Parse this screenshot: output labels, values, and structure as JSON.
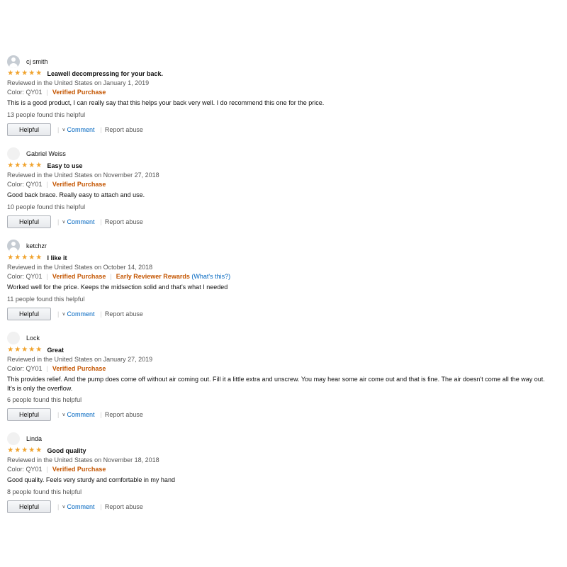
{
  "reviews": [
    {
      "name": "cj smith",
      "avatar": "filled",
      "stars": 5,
      "title": "Leawell decompressing for your back.",
      "date": "Reviewed in the United States on January 1, 2019",
      "color": "Color: QY01",
      "verified": "Verified Purchase",
      "body": "This is a good product, I can really say that this helps your back very well. I do recommend this one for the price.",
      "helpful_count": "13 people found this helpful",
      "helpful_label": "Helpful",
      "comment_label": "Comment",
      "report_label": "Report abuse"
    },
    {
      "name": "Gabriel Weiss",
      "avatar": "blank",
      "stars": 5,
      "title": "Easy to use",
      "date": "Reviewed in the United States on November 27, 2018",
      "color": "Color: QY01",
      "verified": "Verified Purchase",
      "body": "Good back brace. Really easy to attach and use.",
      "helpful_count": "10 people found this helpful",
      "helpful_label": "Helpful",
      "comment_label": "Comment",
      "report_label": "Report abuse"
    },
    {
      "name": "ketchzr",
      "avatar": "filled",
      "stars": 5,
      "title": "I like it",
      "date": "Reviewed in the United States on October 14, 2018",
      "color": "Color: QY01",
      "verified": "Verified Purchase",
      "early_reviewer": "Early Reviewer Rewards",
      "whats_this": "(What's this?)",
      "body": "Worked well for the price. Keeps the midsection solid and that's what I needed",
      "helpful_count": "11 people found this helpful",
      "helpful_label": "Helpful",
      "comment_label": "Comment",
      "report_label": "Report abuse"
    },
    {
      "name": "Lock",
      "avatar": "blank",
      "stars": 5,
      "title": "Great",
      "date": "Reviewed in the United States on January 27, 2019",
      "color": "Color: QY01",
      "verified": "Verified Purchase",
      "body": "This provides relief. And the pump does come off without air coming out. Fill it a little extra and unscrew. You may hear some air come out and that is fine. The air doesn't come all the way out. It's is only the overflow.",
      "helpful_count": "6 people found this helpful",
      "helpful_label": "Helpful",
      "comment_label": "Comment",
      "report_label": "Report abuse"
    },
    {
      "name": "Linda",
      "avatar": "blank",
      "stars": 5,
      "title": "Good quality",
      "date": "Reviewed in the United States on November 18, 2018",
      "color": "Color: QY01",
      "verified": "Verified Purchase",
      "body": "Good quality. Feels very sturdy and comfortable in my hand",
      "helpful_count": "8 people found this helpful",
      "helpful_label": "Helpful",
      "comment_label": "Comment",
      "report_label": "Report abuse"
    }
  ],
  "colors": {
    "star": "#f0a22b",
    "verified": "#c45500",
    "link": "#0066c0"
  },
  "icons": {
    "star": "star-icon",
    "chevron": "chevron-down-icon",
    "avatar": "user-avatar-icon"
  }
}
